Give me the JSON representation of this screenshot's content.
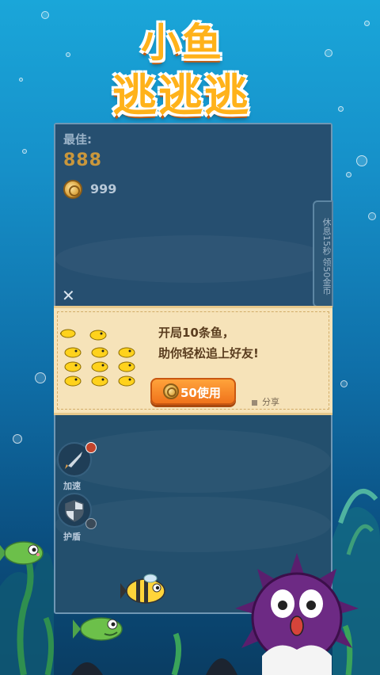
{
  "title": {
    "line1": "小鱼",
    "line2": "逃逃逃"
  },
  "scores": {
    "best_label": "最佳:",
    "best_value": "888",
    "coins": "999"
  },
  "rest_tab": {
    "label": "休息15秒 领50金币"
  },
  "close": {
    "icon": "close-icon",
    "glyph": "✕"
  },
  "offer": {
    "line1": "开局10条鱼，",
    "line2": "助你轻松追上好友!",
    "button_label": "50使用",
    "share_label": "分享"
  },
  "boosters": [
    {
      "label": "加速",
      "icon": "rocket-icon"
    },
    {
      "label": "护盾",
      "icon": "shield-icon"
    }
  ],
  "colors": {
    "title": "#ffb21a",
    "panel": "#234f6d",
    "banner": "#f6e3b9",
    "button": "#f0731b",
    "best_score": "#c9973c"
  }
}
